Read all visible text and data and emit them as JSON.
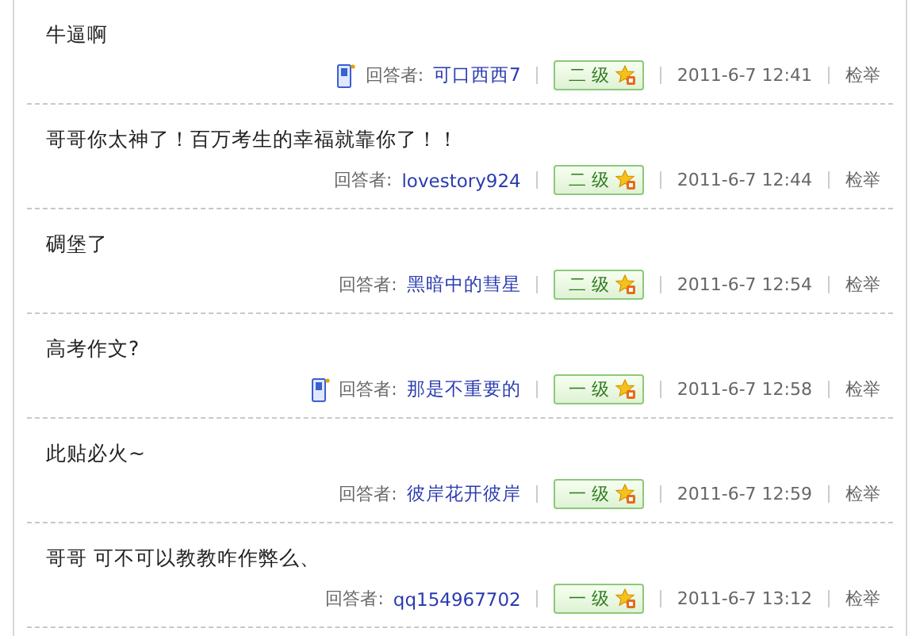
{
  "answers": [
    {
      "text": "牛逼啊",
      "mobile": true,
      "label": "回答者:",
      "author": "可口西西7",
      "level": "二 级",
      "time": "2011-6-7 12:41",
      "report": "检举"
    },
    {
      "text": "哥哥你太神了！百万考生的幸福就靠你了！！",
      "mobile": false,
      "label": "回答者:",
      "author": "lovestory924",
      "level": "二 级",
      "time": "2011-6-7 12:44",
      "report": "检举"
    },
    {
      "text": "碉堡了",
      "mobile": false,
      "label": "回答者:",
      "author": "黑暗中的彗星",
      "level": "二 级",
      "time": "2011-6-7 12:54",
      "report": "检举"
    },
    {
      "text": "高考作文?",
      "mobile": true,
      "label": "回答者:",
      "author": "那是不重要的",
      "level": "一 级",
      "time": "2011-6-7 12:58",
      "report": "检举"
    },
    {
      "text": "此贴必火~",
      "mobile": false,
      "label": "回答者:",
      "author": "彼岸花开彼岸",
      "level": "一 级",
      "time": "2011-6-7 12:59",
      "report": "检举"
    },
    {
      "text": "哥哥 可不可以教教咋作弊么、",
      "mobile": false,
      "label": "回答者:",
      "author": "qq154967702",
      "level": "一 级",
      "time": "2011-6-7 13:12",
      "report": "检举"
    }
  ]
}
